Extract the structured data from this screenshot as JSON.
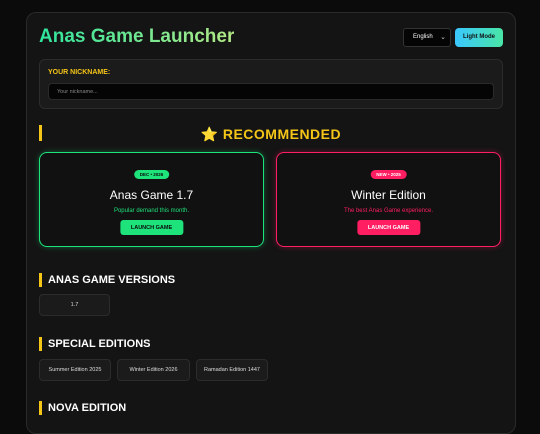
{
  "header": {
    "title": "Anas Game Launcher",
    "language": "English",
    "mode_button": "Light Mode"
  },
  "nickname": {
    "label": "YOUR NICKNAME:",
    "placeholder": "Your nickname..."
  },
  "recommended": {
    "title": "RECOMMENDED",
    "icon": "star-icon",
    "cards": [
      {
        "badge": "DEC • 2026",
        "title": "Anas Game 1.7",
        "subtitle": "Popular demand this month.",
        "button": "LAUNCH GAME",
        "accent": "#1ee27a"
      },
      {
        "badge": "NEW • 2025",
        "title": "Winter Edition",
        "subtitle": "The best Anas Game experience.",
        "button": "LAUNCH GAME",
        "accent": "#ff1e62"
      }
    ]
  },
  "versions": {
    "title": "ANAS GAME VERSIONS",
    "items": [
      "1.7"
    ]
  },
  "special": {
    "title": "SPECIAL EDITIONS",
    "items": [
      "Summer Edition 2025",
      "Winter Edition 2026",
      "Ramadan Edition 1447"
    ]
  },
  "nova": {
    "title": "NOVA EDITION"
  },
  "colors": {
    "accent_yellow": "#f5c518",
    "accent_green": "#1ee27a",
    "accent_red": "#ff1e62"
  }
}
